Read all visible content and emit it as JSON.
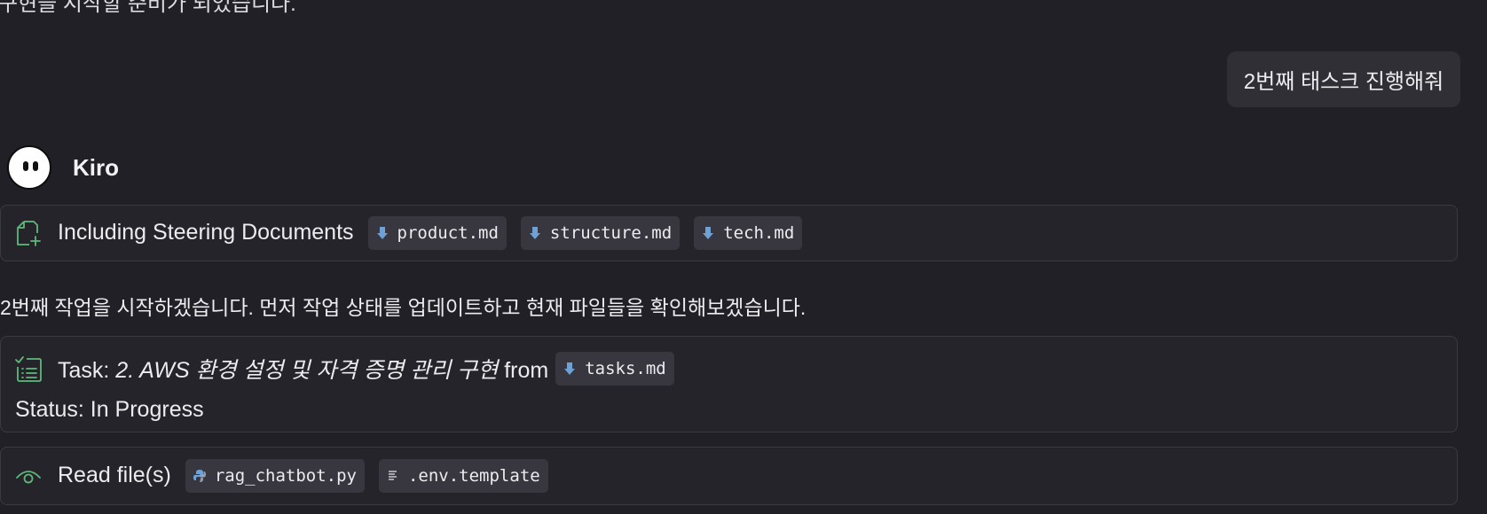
{
  "top_partial_text": "구현을 시작할 준비가 되었습니다.",
  "user_message": "2번째 태스크 진행해줘",
  "agent": {
    "name": "Kiro"
  },
  "steering": {
    "title": "Including Steering Documents",
    "files": [
      "product.md",
      "structure.md",
      "tech.md"
    ],
    "file_icon": "markdown-down-arrow-icon"
  },
  "assistant_message": "2번째 작업을 시작하겠습니다. 먼저 작업 상태를 업데이트하고 현재 파일들을 확인해보겠습니다.",
  "task": {
    "prefix": "Task: ",
    "name": "2. AWS 환경 설정 및 자격 증명 관리 구현",
    "from_label": " from",
    "file": "tasks.md",
    "status": "Status: In Progress"
  },
  "read_files": {
    "title": "Read file(s)",
    "files": [
      {
        "name": "rag_chatbot.py",
        "icon": "python-icon"
      },
      {
        "name": ".env.template",
        "icon": "text-lines-icon"
      }
    ]
  },
  "colors": {
    "background": "#212026",
    "card_border": "#3b3a42",
    "chip_bg": "#38373f",
    "accent_green": "#5fb87a",
    "md_icon_blue": "#6ea1d6"
  }
}
